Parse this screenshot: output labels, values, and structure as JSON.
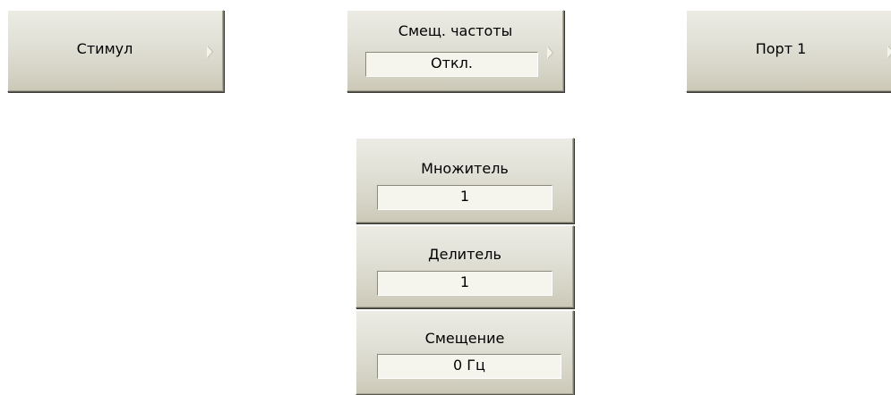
{
  "stimulus_button": {
    "label": "Стимул",
    "icon": "submenu-arrow-icon"
  },
  "freq_offset_button": {
    "label": "Смещ. частоты",
    "value": "Откл.",
    "icon": "submenu-arrow-icon"
  },
  "port_button": {
    "label": "Порт 1",
    "icon": "submenu-arrow-icon"
  },
  "menu": {
    "multiplier": {
      "label": "Множитель",
      "value": "1"
    },
    "divider": {
      "label": "Делитель",
      "value": "1"
    },
    "offset": {
      "label": "Смещение",
      "value": "0 Гц"
    }
  }
}
